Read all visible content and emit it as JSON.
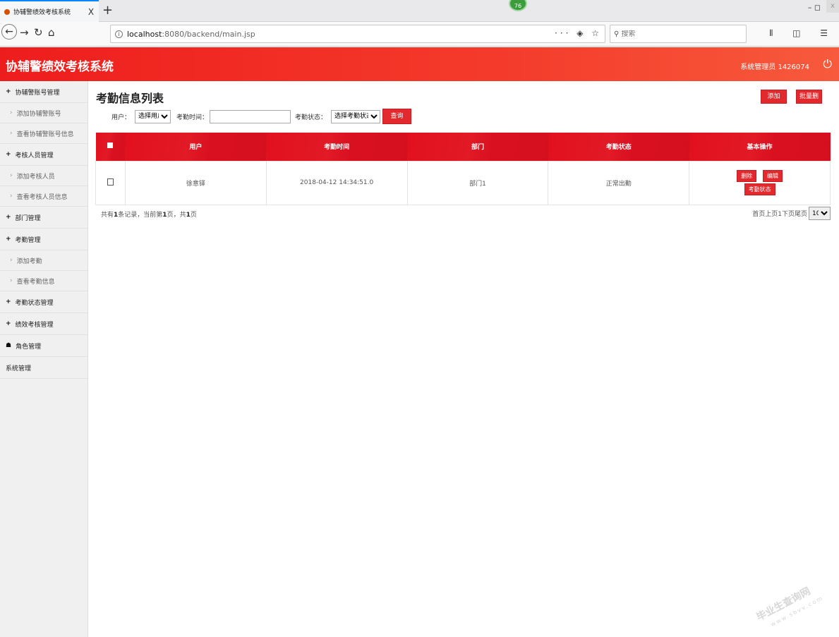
{
  "browser": {
    "tab_title": "协辅警绩效考核系统",
    "tab_close": "X",
    "new_tab": "+",
    "ext_badge": "76",
    "url_host": "localhost",
    "url_path": ":8080/backend/main.jsp",
    "search_placeholder": "搜索"
  },
  "app": {
    "title": "协辅警绩效考核系统",
    "admin": "系统管理员 1426074"
  },
  "sidebar": {
    "items": [
      {
        "prefix": "+",
        "label": "协辅警账号管理",
        "sub": false
      },
      {
        "prefix": "›",
        "label": "添加协辅警账号",
        "sub": true
      },
      {
        "prefix": "›",
        "label": "查看协辅警账号信息",
        "sub": true
      },
      {
        "prefix": "+",
        "label": "考核人员管理",
        "sub": false
      },
      {
        "prefix": "›",
        "label": "添加考核人员",
        "sub": true
      },
      {
        "prefix": "›",
        "label": "查看考核人员信息",
        "sub": true
      },
      {
        "prefix": "+",
        "label": "部门管理",
        "sub": false
      },
      {
        "prefix": "+",
        "label": "考勤管理",
        "sub": false
      },
      {
        "prefix": "›",
        "label": "添加考勤",
        "sub": true
      },
      {
        "prefix": "›",
        "label": "查看考勤信息",
        "sub": true
      },
      {
        "prefix": "+",
        "label": "考勤状态管理",
        "sub": false
      },
      {
        "prefix": "+",
        "label": "绩效考核管理",
        "sub": false
      },
      {
        "prefix": "☗",
        "label": "角色管理",
        "sub": false
      },
      {
        "prefix": "",
        "label": "系统管理",
        "sub": false
      }
    ]
  },
  "main": {
    "title": "考勤信息列表",
    "add_label": "添加",
    "batch_delete_label": "批量删除",
    "filter": {
      "user_label": "用户：",
      "user_select": "选择用户",
      "time_label": "考勤时间：",
      "time_value": "",
      "status_label": "考勤状态：",
      "status_select": "选择考勤状态",
      "query_label": "查询"
    },
    "table": {
      "headers": [
        "用户",
        "考勤时间",
        "部门",
        "考勤状态",
        "基本操作"
      ],
      "rows": [
        {
          "user": "徐意铎",
          "time": "2018-04-12 14:34:51.0",
          "dept": "部门1",
          "status": "正常出勤",
          "ops": [
            "删除",
            "编辑",
            "考勤状态"
          ]
        }
      ]
    },
    "footer": {
      "prefix": "共有",
      "count": "1",
      "mid1": "条记录，当前第",
      "page": "1",
      "mid2": "页，共",
      "total": "1",
      "suffix": "页"
    },
    "pager": {
      "text": "首页上页1下页尾页",
      "page_size": "10"
    }
  },
  "watermark": {
    "main": "毕业生查询网",
    "sub": "www.sbvv.com"
  }
}
